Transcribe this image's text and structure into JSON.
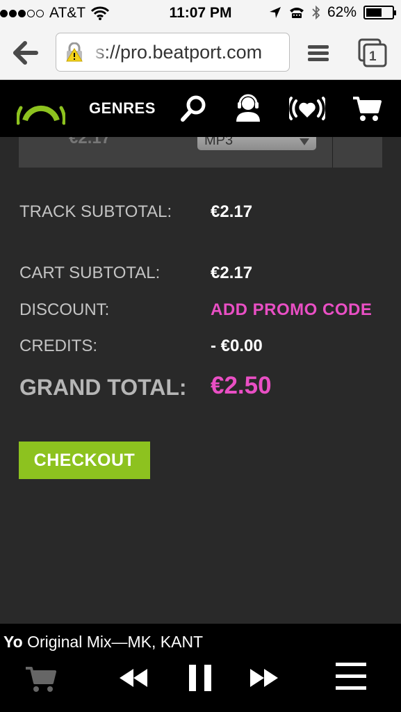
{
  "status_bar": {
    "signal_filled": 3,
    "signal_total": 5,
    "carrier": "AT&T",
    "time": "11:07 PM",
    "battery_text": "62%",
    "battery_level": 0.62
  },
  "browser": {
    "url_text": "s://pro.beatport.com",
    "tab_count": "1",
    "icons": [
      "back-arrow-icon",
      "lock-warning-icon",
      "reader-list-icon",
      "tabs-icon"
    ]
  },
  "site_nav": {
    "genres_label": "GENRES",
    "icons": [
      "beatport-logo",
      "search-icon",
      "user-headphones-icon",
      "heart-radio-icon",
      "cart-icon"
    ]
  },
  "track_row": {
    "price": "€2.17",
    "format": "MP3"
  },
  "totals": {
    "track_subtotal_label": "TRACK SUBTOTAL:",
    "track_subtotal_value": "€2.17",
    "cart_subtotal_label": "CART SUBTOTAL:",
    "cart_subtotal_value": "€2.17",
    "discount_label": "DISCOUNT:",
    "discount_action": "ADD PROMO CODE",
    "credits_label": "CREDITS:",
    "credits_value": "- €0.00",
    "grand_total_label": "GRAND TOTAL:",
    "grand_total_value": "€2.50"
  },
  "checkout_label": "CHECKOUT",
  "player": {
    "track_title": "Yo",
    "track_detail": " Original Mix—MK, KANT",
    "icons": [
      "cart-icon",
      "rewind-icon",
      "pause-icon",
      "fast-forward-icon",
      "menu-icon"
    ]
  },
  "colors": {
    "accent_green": "#8dc21f",
    "accent_pink": "#e94fc4",
    "background": "#292929",
    "nav_black": "#000000"
  }
}
